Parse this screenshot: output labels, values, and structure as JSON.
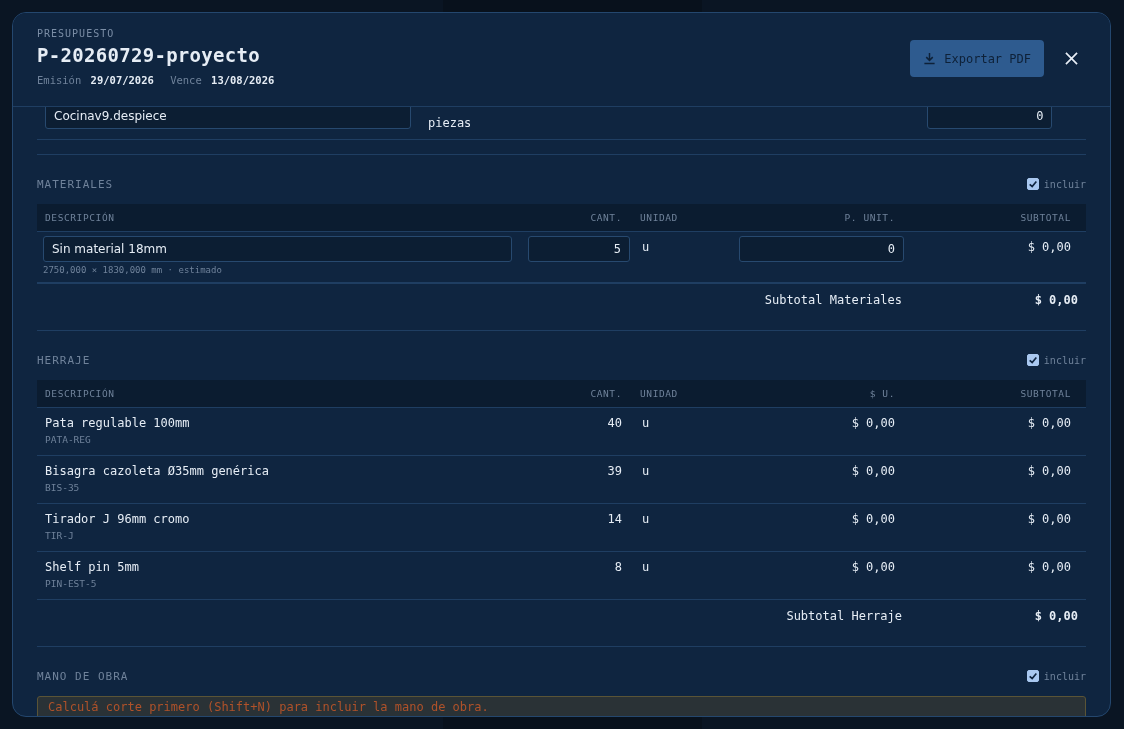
{
  "header": {
    "eyebrow": "PRESUPUESTO",
    "title": "P-20260729-proyecto",
    "issued_label": "Emisión",
    "issued": "29/07/2026",
    "due_label": "Vence",
    "due": "13/08/2026",
    "export_button": "Exportar PDF"
  },
  "cut_row": {
    "description": "Cocinav9.despiece",
    "detail": "piezas",
    "price": "0"
  },
  "materials": {
    "title": "MATERIALES",
    "include_label": "incluir",
    "include": true,
    "columns": [
      "DESCRIPCIÓN",
      "CANT.",
      "UNIDAD",
      "P. UNIT.",
      "SUBTOTAL"
    ],
    "rows": [
      {
        "description": "Sin material 18mm",
        "note": "2750,000 × 1830,000 mm · estimado",
        "quantity": "5",
        "unit": "u",
        "price": "0",
        "subtotal": "$ 0,00"
      }
    ],
    "total_label": "Subtotal Materiales",
    "total": "$ 0,00"
  },
  "hardware": {
    "title": "HERRAJE",
    "include_label": "incluir",
    "include": true,
    "columns": [
      "DESCRIPCIÓN",
      "CANT.",
      "UNIDAD",
      "$ U.",
      "SUBTOTAL"
    ],
    "rows": [
      {
        "name": "Pata regulable 100mm",
        "code": "PATA-REG",
        "quantity": "40",
        "unit": "u",
        "price": "$ 0,00",
        "subtotal": "$ 0,00"
      },
      {
        "name": "Bisagra cazoleta Ø35mm genérica",
        "code": "BIS-35",
        "quantity": "39",
        "unit": "u",
        "price": "$ 0,00",
        "subtotal": "$ 0,00"
      },
      {
        "name": "Tirador J 96mm cromo",
        "code": "TIR-J",
        "quantity": "14",
        "unit": "u",
        "price": "$ 0,00",
        "subtotal": "$ 0,00"
      },
      {
        "name": "Shelf pin 5mm",
        "code": "PIN-EST-5",
        "quantity": "8",
        "unit": "u",
        "price": "$ 0,00",
        "subtotal": "$ 0,00"
      }
    ],
    "total_label": "Subtotal Herraje",
    "total": "$ 0,00"
  },
  "labor": {
    "title": "MANO DE OBRA",
    "include_label": "incluir",
    "include": true,
    "warning": "Calculá corte primero (Shift+N) para incluir la mano de obra."
  }
}
